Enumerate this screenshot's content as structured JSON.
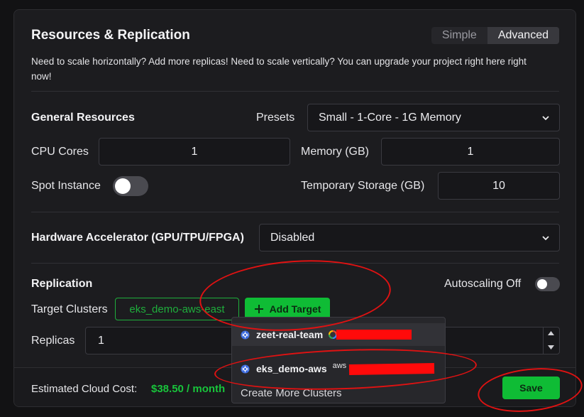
{
  "header": {
    "title": "Resources & Replication",
    "mode_simple": "Simple",
    "mode_advanced": "Advanced",
    "description": "Need to scale horizontally? Add more replicas! Need to scale vertically? You can upgrade your project right here right now!"
  },
  "general": {
    "section_label": "General Resources",
    "presets_label": "Presets",
    "presets_value": "Small - 1-Core - 1G Memory",
    "cpu_label": "CPU Cores",
    "cpu_value": "1",
    "memory_label": "Memory (GB)",
    "memory_value": "1",
    "spot_label": "Spot Instance",
    "spot_enabled": false,
    "temp_storage_label": "Temporary Storage (GB)",
    "temp_storage_value": "10"
  },
  "hardware": {
    "label": "Hardware Accelerator (GPU/TPU/FPGA)",
    "value": "Disabled"
  },
  "replication": {
    "section_label": "Replication",
    "autoscaling_label": "Autoscaling Off",
    "autoscaling_enabled": false,
    "target_clusters_label": "Target Clusters",
    "target_cluster_chip": "eks_demo-aws-east",
    "add_target_label": "Add Target",
    "replicas_label": "Replicas",
    "replicas_value": "1"
  },
  "cluster_dropdown": {
    "items": [
      {
        "name": "zeet-real-team",
        "provider_icon": "gcp-icon"
      },
      {
        "name": "eks_demo-aws",
        "provider_icon": "aws-icon",
        "provider_text": "aws"
      }
    ],
    "create_more": "Create More Clusters"
  },
  "footer": {
    "cost_label": "Estimated Cloud Cost:",
    "cost_value": "$38.50 / month",
    "save_label": "Save"
  },
  "colors": {
    "accent_green": "#0fbc35",
    "annotation_red": "#e01212",
    "redaction_red": "#ff0a0a"
  }
}
